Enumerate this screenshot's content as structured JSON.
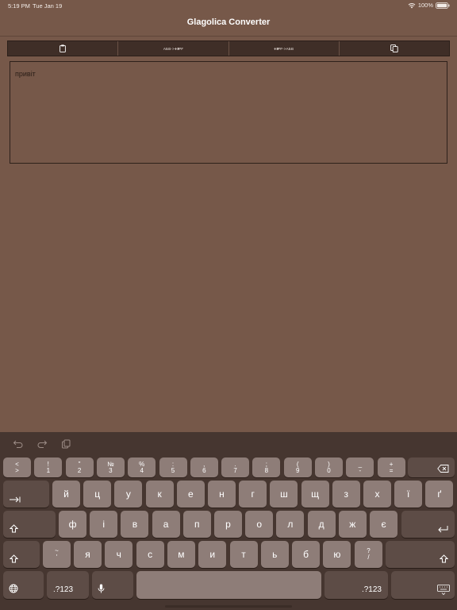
{
  "status": {
    "time": "5:19 PM",
    "date": "Tue Jan 19",
    "battery": "100%"
  },
  "nav": {
    "title": "Glagolica Converter"
  },
  "toolbar": {
    "paste_icon": "clipboard-icon",
    "to_glagolitic": "АБВ->ⰀⰁⰂ",
    "to_cyrillic": "ⰀⰁⰂ->АБВ",
    "copy_icon": "copy-icon"
  },
  "editor": {
    "text": "привіт"
  },
  "keyboard": {
    "numrow": [
      {
        "top": "<",
        "bottom": ">"
      },
      {
        "top": "!",
        "bottom": "1"
      },
      {
        "top": "\"",
        "bottom": "2"
      },
      {
        "top": "№",
        "bottom": "3"
      },
      {
        "top": "%",
        "bottom": "4"
      },
      {
        "top": ":",
        "bottom": "5"
      },
      {
        "top": ",",
        "bottom": "6"
      },
      {
        "top": ".",
        "bottom": "7"
      },
      {
        "top": ";",
        "bottom": "8"
      },
      {
        "top": "(",
        "bottom": "9"
      },
      {
        "top": ")",
        "bottom": "0"
      },
      {
        "top": "_",
        "bottom": "-"
      },
      {
        "top": "+",
        "bottom": "="
      }
    ],
    "row1": [
      "й",
      "ц",
      "у",
      "к",
      "е",
      "н",
      "г",
      "ш",
      "щ",
      "з",
      "х",
      "ї",
      "ґ"
    ],
    "row2": [
      "ф",
      "і",
      "в",
      "а",
      "п",
      "р",
      "о",
      "л",
      "д",
      "ж",
      "є"
    ],
    "row3": [
      "я",
      "ч",
      "с",
      "м",
      "и",
      "т",
      "ь",
      "б",
      "ю"
    ],
    "tilde_top": "~",
    "tilde_bottom": "'",
    "q_top": "?",
    "q_bottom": "/",
    "num_label": ".?123"
  }
}
